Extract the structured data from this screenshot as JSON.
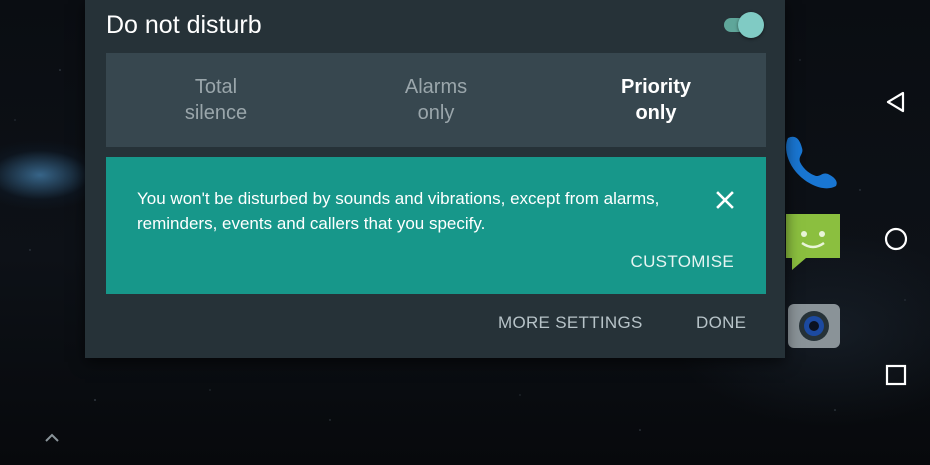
{
  "dialog": {
    "title": "Do not disturb",
    "toggle_on": true,
    "modes": [
      {
        "label": "Total\nsilence",
        "selected": false
      },
      {
        "label": "Alarms\nonly",
        "selected": false
      },
      {
        "label": "Priority\nonly",
        "selected": true
      }
    ],
    "info": {
      "text": "You won't be disturbed by sounds and vibrations, except from alarms, reminders, events and callers that you specify.",
      "close_icon": "close-icon",
      "customise_label": "CUSTOMISE"
    },
    "actions": {
      "more_settings": "MORE SETTINGS",
      "done": "DONE"
    }
  },
  "nav": {
    "back_icon": "back-triangle-icon",
    "home_icon": "home-circle-icon",
    "recents_icon": "recents-square-icon"
  },
  "home_screen": {
    "apps": [
      "phone-icon",
      "messaging-icon",
      "camera-icon"
    ],
    "drawer_icon": "chevron-up-icon"
  },
  "colors": {
    "dialog_bg": "#263238",
    "segment_bg": "#37474f",
    "accent_teal": "#17978a",
    "toggle_thumb": "#80cbc4"
  }
}
